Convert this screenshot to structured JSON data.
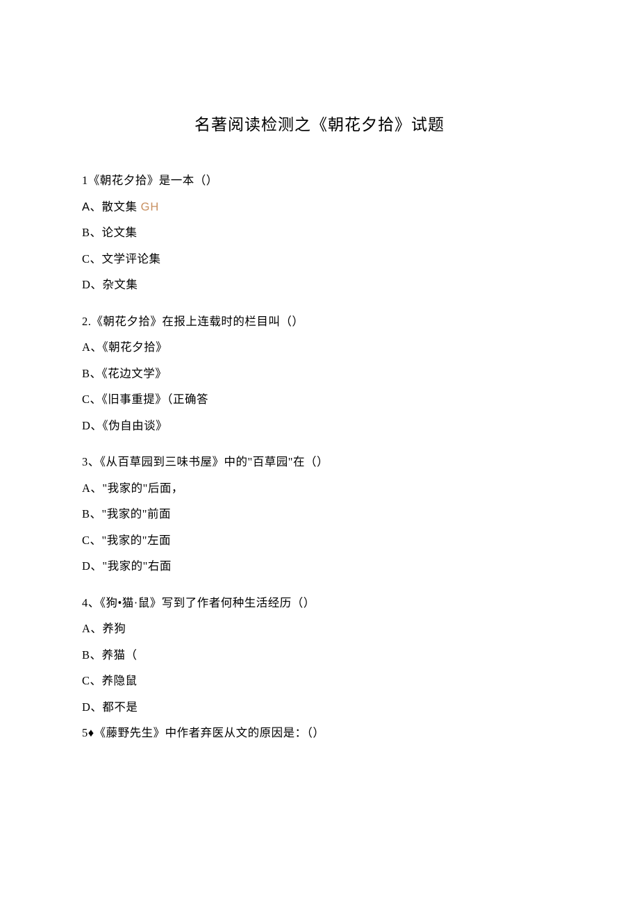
{
  "title": "名著阅读检测之《朝花夕拾》试题",
  "q1": {
    "stem": "1《朝花夕拾》是一本（）",
    "a_prefix": "A、散文集 ",
    "a_gh": "GH",
    "b": "B、论文集",
    "c": "C、文学评论集",
    "d": "D、杂文集"
  },
  "q2": {
    "stem": "2.《朝花夕拾》在报上连载时的栏目叫（）",
    "a": "A、《朝花夕拾》",
    "b": "B、《花边文学》",
    "c": "C、《旧事重提》（正确答",
    "d": "D、《伪自由谈》"
  },
  "q3": {
    "stem": "3、《从百草园到三味书屋》中的\"百草园\"在（）",
    "a": "A、\"我家的\"后面，",
    "b": "B、\"我家的\"前面",
    "c": "C、\"我家的\"左面",
    "d": "D、\"我家的\"右面"
  },
  "q4": {
    "stem": "4、《狗•猫·鼠》写到了作者何种生活经历（）",
    "a": "A、养狗",
    "b": "B、养猫（",
    "c": "C、养隐鼠",
    "d": "D、都不是"
  },
  "q5": {
    "stem": "5♦《藤野先生》中作者弃医从文的原因是：（）"
  }
}
